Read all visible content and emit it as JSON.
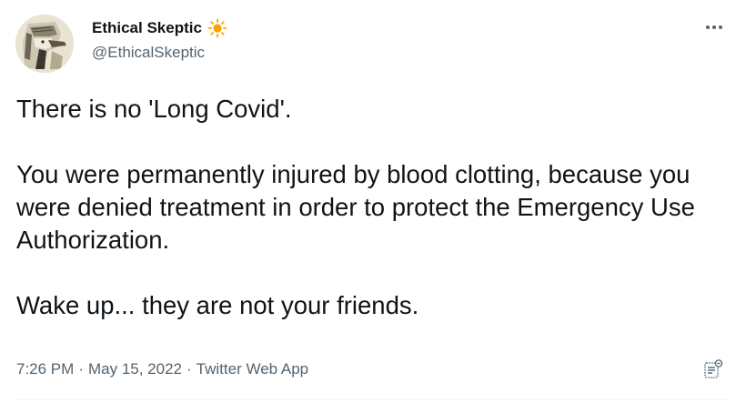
{
  "author": {
    "display_name": "Ethical Skeptic",
    "handle": "@EthicalSkeptic",
    "badge_icon": "sun-icon"
  },
  "tweet": {
    "text": "There is no 'Long Covid'.\n\nYou were permanently injured by blood clotting, because you were denied treatment in order to protect the Emergency Use Authorization.\n\nWake up...  they are not your friends.",
    "time": "7:26 PM",
    "date": "May 15, 2022",
    "separator": "·",
    "source": "Twitter Web App"
  },
  "icons": {
    "more": "more-options-icon",
    "analytics": "analytics-icon"
  },
  "colors": {
    "text": "#0f1419",
    "secondary": "#536471",
    "sun": "#f7a400"
  }
}
